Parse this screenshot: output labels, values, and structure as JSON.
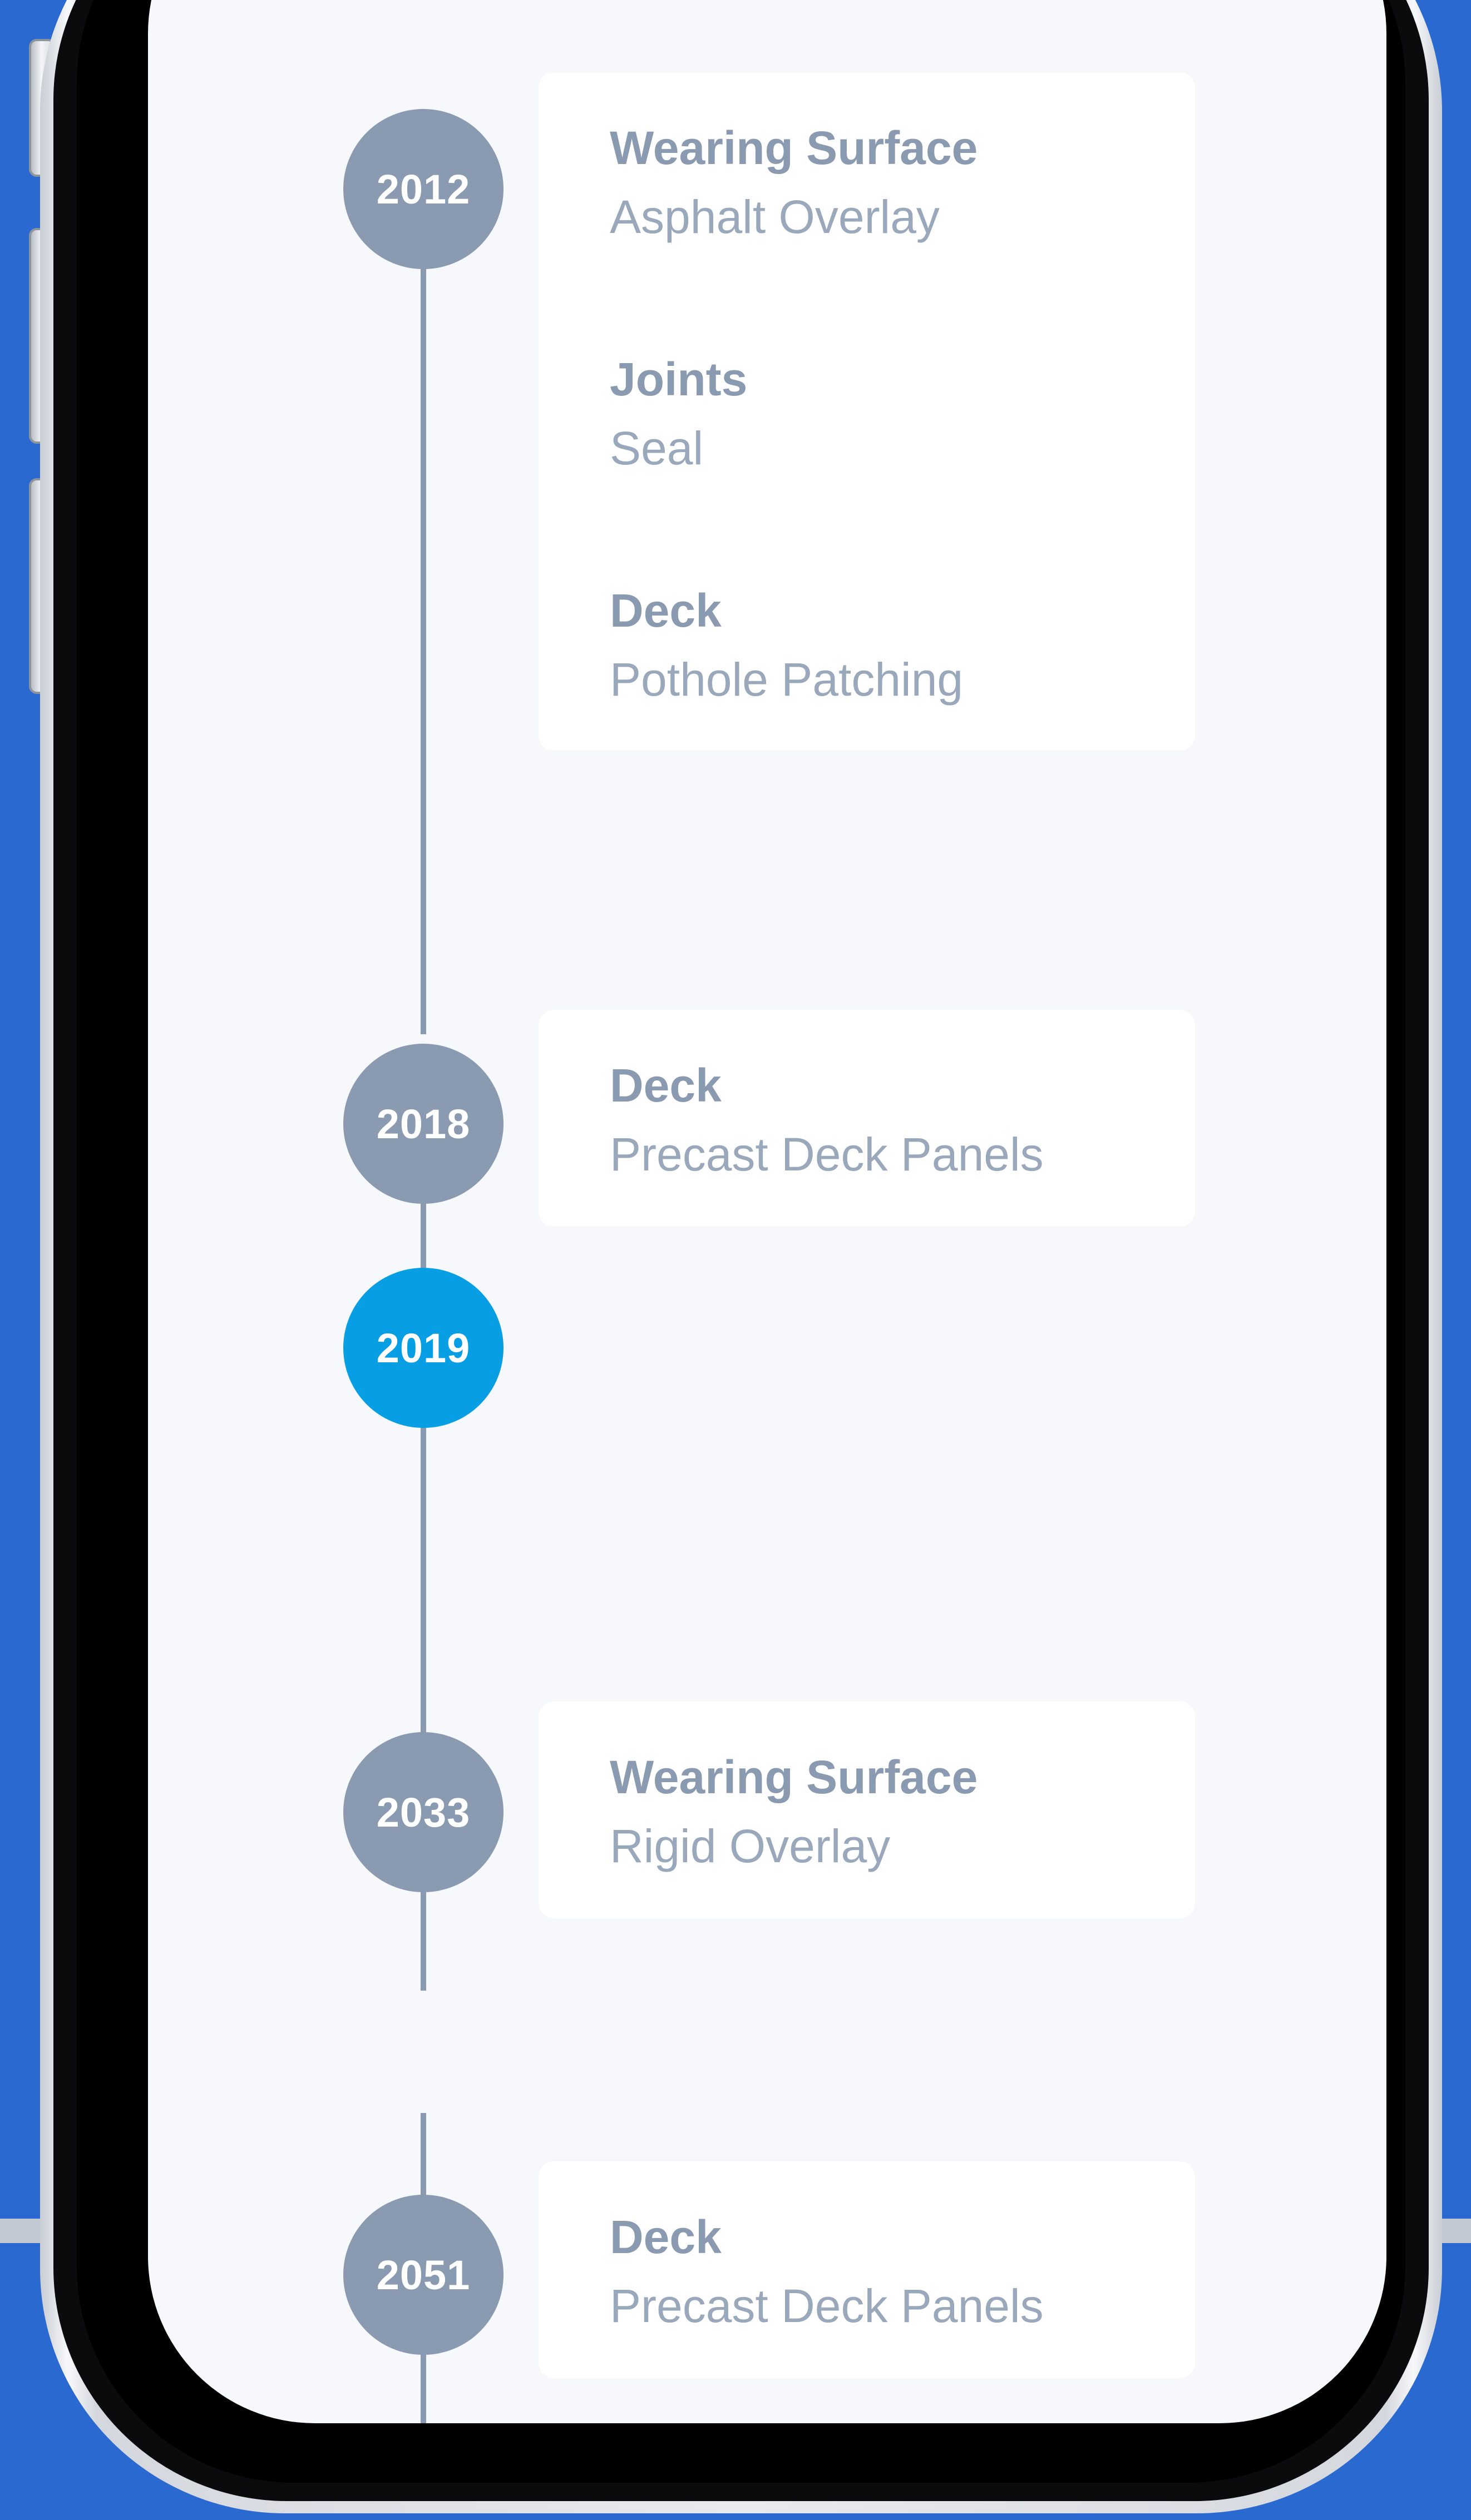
{
  "timeline": {
    "events": [
      {
        "year": "2012",
        "current": false,
        "items": [
          {
            "category": "Wearing Surface",
            "action": "Asphalt Overlay"
          },
          {
            "category": "Joints",
            "action": "Seal"
          },
          {
            "category": "Deck",
            "action": "Pothole Patching"
          }
        ]
      },
      {
        "year": "2018",
        "current": false,
        "items": [
          {
            "category": "Deck",
            "action": "Precast Deck Panels"
          }
        ]
      },
      {
        "year": "2019",
        "current": true,
        "items": []
      },
      {
        "year": "2033",
        "current": false,
        "items": [
          {
            "category": "Wearing Surface",
            "action": "Rigid Overlay"
          }
        ]
      },
      {
        "year": "2051",
        "current": false,
        "items": [
          {
            "category": "Deck",
            "action": "Precast Deck Panels"
          }
        ]
      }
    ]
  },
  "colors": {
    "background": "#2a69cf",
    "screen": "#f6f8fb",
    "card": "#ffffff",
    "past_year": "#8a9ab0",
    "current_year": "#089ee4",
    "timeline_line": "#8a9ab0",
    "text_primary": "#8a9ab0",
    "text_secondary": "#9aa8bb"
  }
}
